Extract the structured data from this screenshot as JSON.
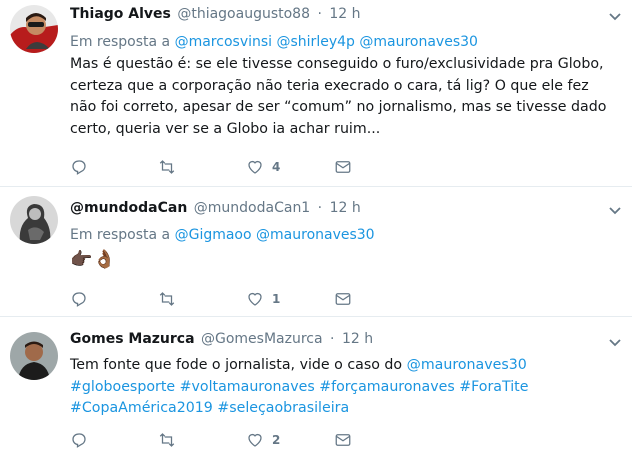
{
  "tweets": [
    {
      "name": "Thiago Alves",
      "handle": "@thiagoaugusto88",
      "time": "12 h",
      "reply_prefix": "Em resposta a",
      "reply_mentions": [
        "@marcosvinsi",
        "@shirley4p",
        "@mauronaves30"
      ],
      "text": "Mas é questão é: se ele tivesse conseguido o furo/exclusividade pra Globo, certeza que a corporação não teria execrado o cara, tá lig? O que ele fez não foi correto, apesar de ser “comum” no jornalismo, mas se tivesse dado certo, queria ver se a Globo ia achar ruim...",
      "likes": "4",
      "avatar_colors": {
        "bg": "#b71c1c",
        "skin": "#c58b63",
        "hair": "#2a1a12"
      }
    },
    {
      "name": "@mundodaCan",
      "handle": "@mundodaCan1",
      "time": "12 h",
      "reply_prefix": "Em resposta a",
      "reply_mentions": [
        "@Gigmaoo",
        "@mauronaves30"
      ],
      "text": "👉🏿👌🏾",
      "likes": "1",
      "avatar_colors": {
        "bg": "#cfcfcf",
        "fg": "#3a3a3a"
      }
    },
    {
      "name": "Gomes Mazurca",
      "handle": "@GomesMazurca",
      "time": "12 h",
      "text_plain": "Tem fonte que fode o jornalista, vide o caso do",
      "text_mention": "@mauronaves30",
      "hashtags_line1": "#globoesporte #voltamauronaves #forçamauronaves #ForaTite",
      "hashtags_line2": "#CopaAmérica2019 #seleçaobrasileira",
      "likes": "2",
      "avatar_colors": {
        "bg": "#9ea7a8",
        "skin": "#a06a4a",
        "shirt": "#1c1c1c"
      }
    }
  ],
  "colors": {
    "link": "#1b95e0",
    "secondary_text": "#657786",
    "primary_text": "#14171a",
    "divider": "#e6ecf0"
  },
  "icons": [
    "reply-icon",
    "retweet-icon",
    "like-icon",
    "message-icon",
    "caret-down-icon"
  ]
}
